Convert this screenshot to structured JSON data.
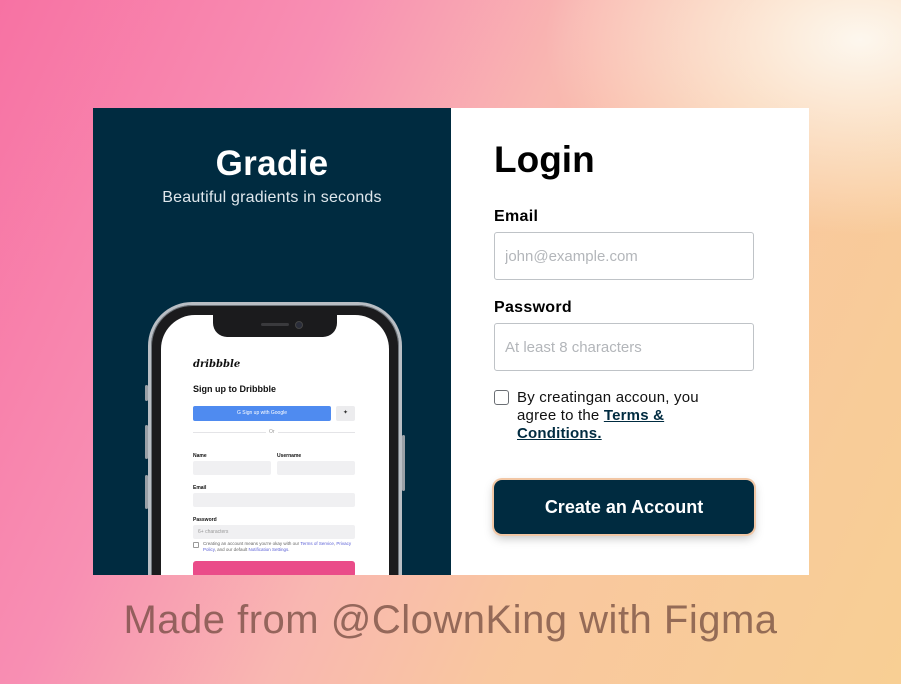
{
  "brand": {
    "title": "Gradie",
    "subtitle": "Beautiful gradients in seconds"
  },
  "phone_preview": {
    "logo": "dribbble",
    "title": "Sign up to Dribbble",
    "google_button": "G  Sign up with Google",
    "twitter_icon": "twitter-icon",
    "divider": "Or",
    "name_label": "Name",
    "username_label": "Username",
    "email_label": "Email",
    "password_label": "Password",
    "password_placeholder": "6+ characters",
    "terms_prefix": "Creating an account means you're okay with our ",
    "terms_link1": "Terms of Service",
    "terms_mid1": ", ",
    "terms_link2": "Privacy Policy",
    "terms_mid2": ", and our default ",
    "terms_link3": "Notification Settings",
    "terms_end": "."
  },
  "login": {
    "title": "Login",
    "email_label": "Email",
    "email_placeholder": "john@example.com",
    "password_label": "Password",
    "password_placeholder": "At least 8 characters",
    "terms_text": "By creatingan accoun, you agree to the ",
    "terms_link": "Terms & Conditions.",
    "terms_checked": false,
    "submit_label": "Create an Account"
  },
  "footer": "Made from @ClownKing with Figma",
  "colors": {
    "panel_dark": "#002b40",
    "dribbble_pink": "#ea4c89",
    "google_blue": "#4f8bf0"
  }
}
